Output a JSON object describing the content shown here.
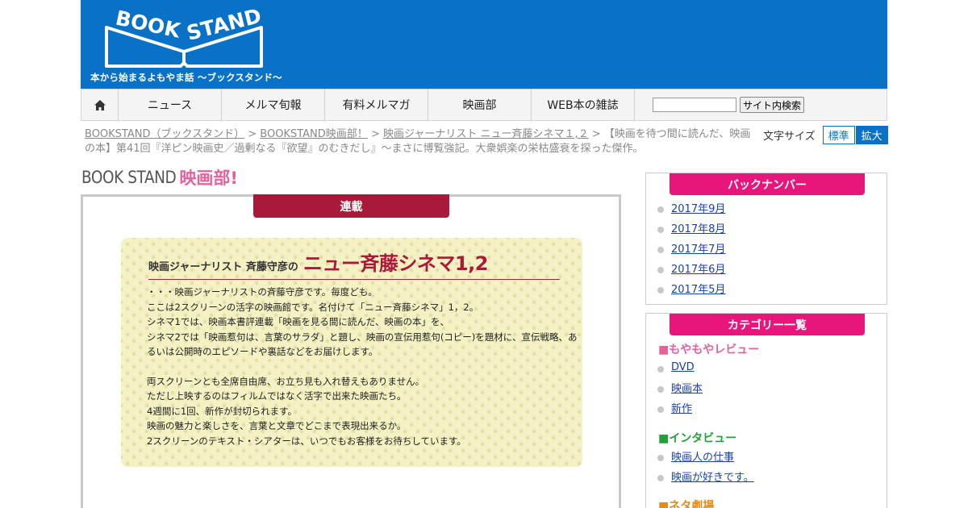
{
  "header": {
    "logo_text": "BOOK STAND",
    "tagline": "本から始まるよもやま話 〜ブックスタンド〜",
    "bg_color": "#0a72c6"
  },
  "nav": {
    "home_icon": "home-icon",
    "items": [
      "ニュース",
      "メルマ旬報",
      "有料メルマガ",
      "映画部",
      "WEB本の雑誌"
    ],
    "search_placeholder": "",
    "search_button": "サイト内検索"
  },
  "breadcrumb": {
    "crumbs": [
      "BOOKSTAND（ブックスタンド）",
      "BOOKSTAND映画部！",
      "映画ジャーナリスト ニュー斉藤シネマ１,２"
    ],
    "separator": ">",
    "current": "【映画を待つ間に読んだ、映画の本】第41回『洋ピン映画史／過剰なる『欲望』のむきだし』〜まさに博覧強記。大衆娯楽の栄枯盛衰を探った傑作。"
  },
  "font_size": {
    "label": "文字サイズ",
    "standard": "標準",
    "large": "拡大"
  },
  "section_title": {
    "main": "BOOK STAND",
    "sub": "映画部!"
  },
  "article": {
    "badge": "連載",
    "intro_author": "映画ジャーナリスト 斉藤守彦の",
    "intro_series": "ニュー斉藤シネマ1,2",
    "para1": [
      "・・・映画ジャーナリストの斉藤守彦です。毎度ども。",
      "ここは2スクリーンの活字の映画館です。名付けて「ニュー斉藤シネマ」1，2。",
      "シネマ1では、映画本書評連載「映画を見る間に読んだ、映画の本」を、",
      "シネマ2では「映画惹句は、言葉のサラダ」と題し、映画の宣伝用惹句(コピー)を題材に、宣伝戦略、あ",
      "るいは公開時のエピソードや裏話などをお届けします。"
    ],
    "para2": [
      "両スクリーンとも全席自由席、お立ち見も入れ替えもありません。",
      "ただし上映するのはフィルムではなく活字で出来た映画たち。",
      "4週間に1回、新作が封切られます。",
      "映画の魅力と楽しさを、言葉と文章でどこまで表現出来るか。",
      "2スクリーンのテキスト・シアターは、いつでもお客様をお待ちしています。"
    ]
  },
  "sidebar": {
    "backnumber_title": "バックナンバー",
    "backnumbers": [
      "2017年9月",
      "2017年8月",
      "2017年7月",
      "2017年6月",
      "2017年5月"
    ],
    "category_title": "カテゴリー一覧",
    "categories": [
      {
        "name": "■もやもやレビュー",
        "color": "#e8609a",
        "items": [
          "DVD",
          "映画本",
          "新作"
        ]
      },
      {
        "name": "■インタビュー",
        "color": "#22a03a",
        "items": [
          "映画人の仕事",
          "映画が好きです。"
        ]
      },
      {
        "name": "■ネタ劇場",
        "color": "#e88a10",
        "items": []
      }
    ]
  }
}
